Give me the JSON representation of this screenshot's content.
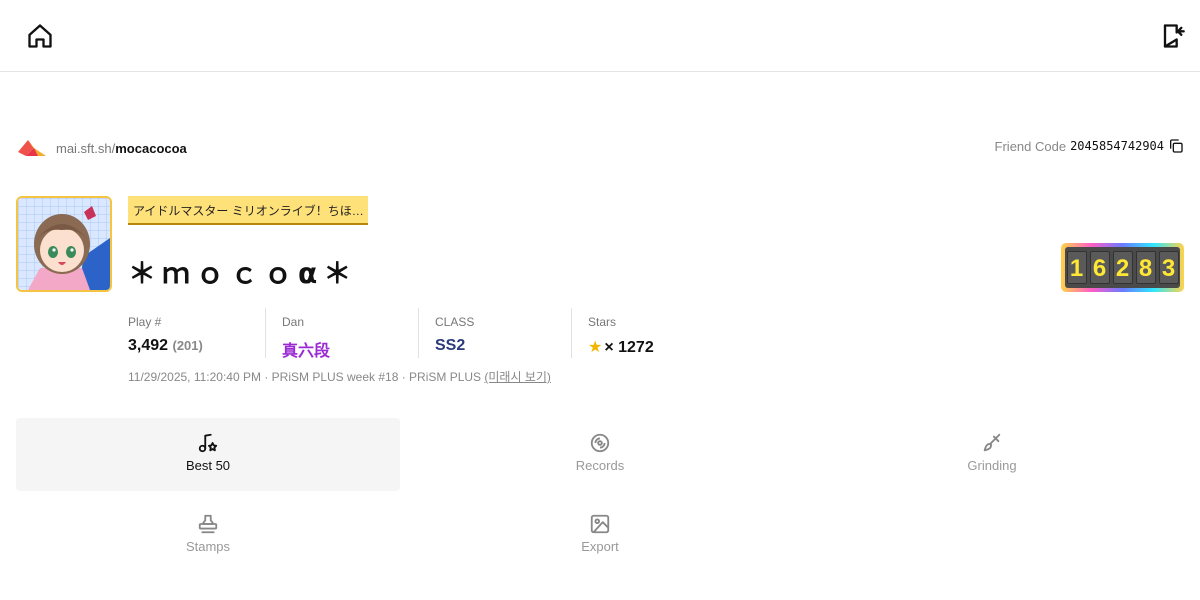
{
  "header": {
    "home_icon": "home-icon",
    "logout_icon": "logout-icon"
  },
  "profile": {
    "url_prefix": "mai.sft.sh/",
    "username": "mocacocoa",
    "friend_code_label": "Friend Code",
    "friend_code": "2045854742904",
    "title": "アイドルマスター ミリオンライブ！ちほ…",
    "name": "＊ｍｏｃｏα＊",
    "rating_digits": [
      "1",
      "6",
      "2",
      "8",
      "3"
    ],
    "accent_colors": {
      "dan": "#9a2bd3",
      "class": "#2a3a7a",
      "star": "#f2b600",
      "title_badge": "#ffe17a"
    }
  },
  "stats": {
    "play_label": "Play #",
    "play_value": "3,492",
    "play_sub": "(201)",
    "dan_label": "Dan",
    "dan_value": "真六段",
    "class_label": "CLASS",
    "class_value": "SS2",
    "stars_label": "Stars",
    "stars_value": "× 1272"
  },
  "meta": {
    "text": "11/29/2025, 11:20:40 PM · PRiSM PLUS week #18 · PRiSM PLUS ",
    "link": "(미래시 보기)"
  },
  "tabs": [
    {
      "label": "Best 50",
      "icon": "music-star-icon",
      "active": true
    },
    {
      "label": "Records",
      "icon": "disc-icon",
      "active": false
    },
    {
      "label": "Grinding",
      "icon": "brush-icon",
      "active": false
    },
    {
      "label": "Stamps",
      "icon": "stamp-icon",
      "active": false
    },
    {
      "label": "Export",
      "icon": "image-icon",
      "active": false
    }
  ]
}
